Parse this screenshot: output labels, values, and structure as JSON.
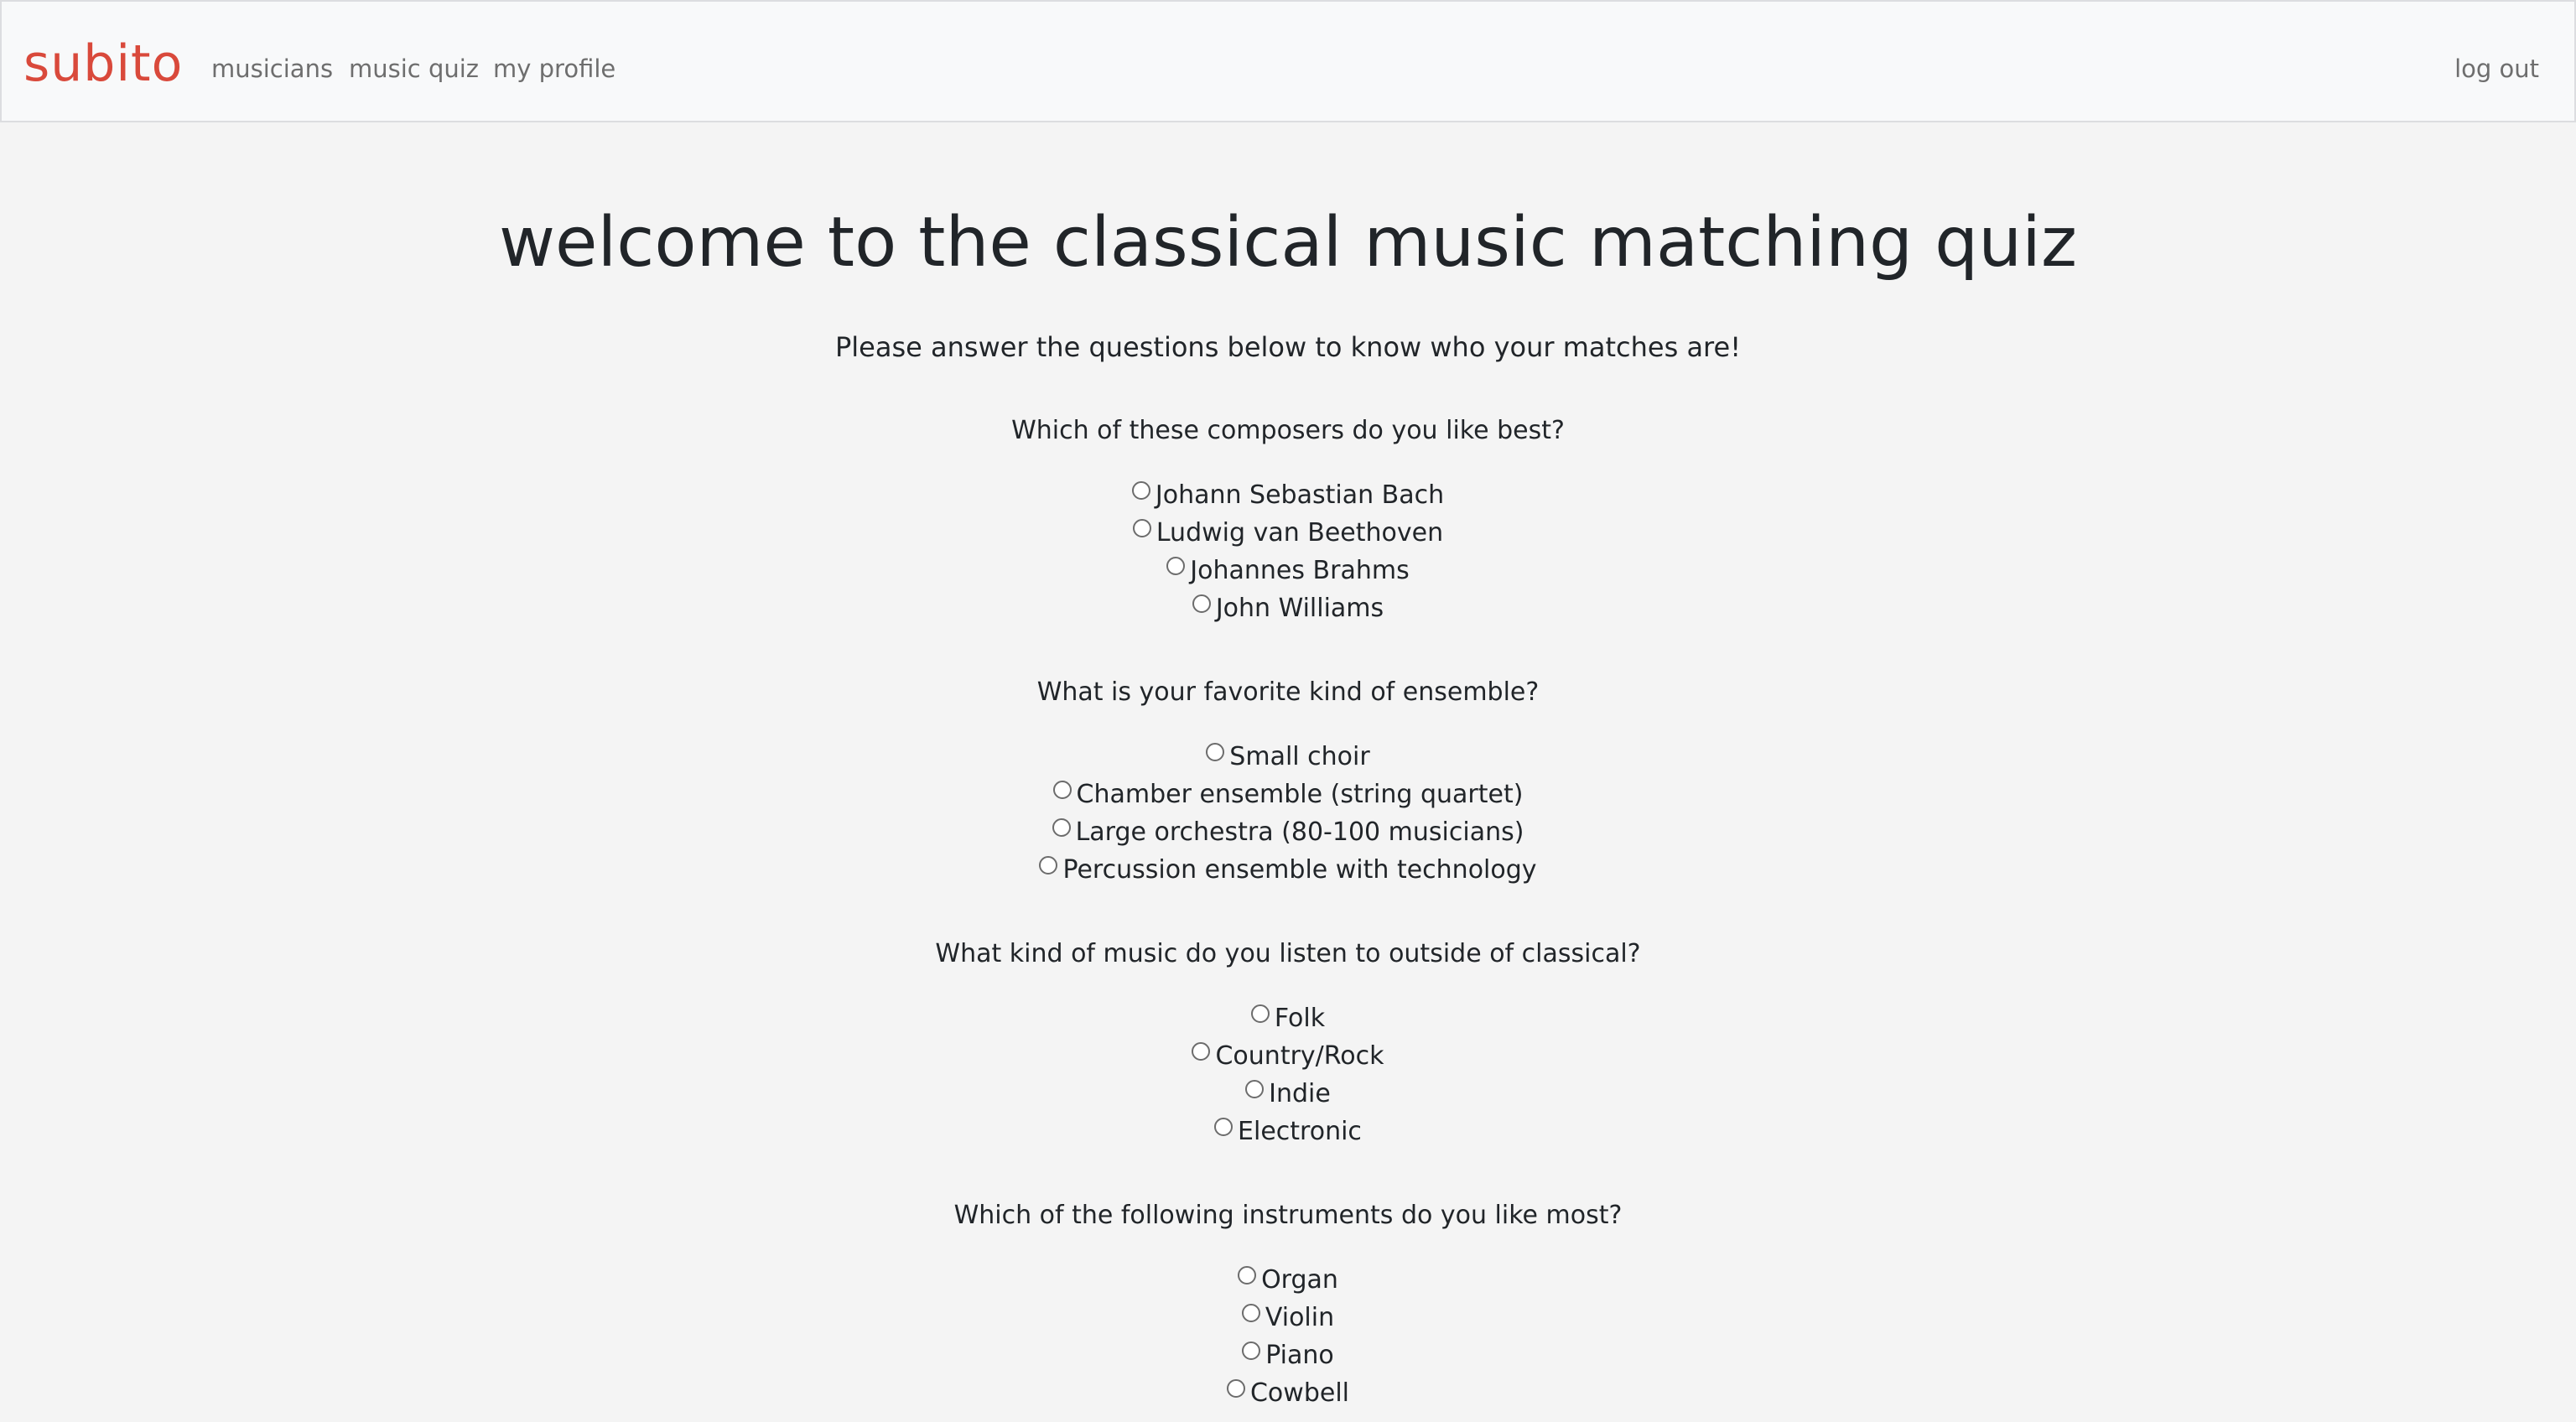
{
  "nav": {
    "brand": "subito",
    "links": [
      "musicians",
      "music quiz",
      "my profile"
    ],
    "logout": "log out"
  },
  "colors": {
    "brand": "#d9493b",
    "nav_background": "#f8f9fa",
    "page_background": "#f4f4f4"
  },
  "page": {
    "title": "welcome to the classical music matching quiz",
    "intro": "Please answer the questions below to know who your matches are!"
  },
  "questions": [
    {
      "text": "Which of these composers do you like best?",
      "options": [
        "Johann Sebastian Bach",
        "Ludwig van Beethoven",
        "Johannes Brahms",
        "John Williams"
      ]
    },
    {
      "text": "What is your favorite kind of ensemble?",
      "options": [
        "Small choir",
        "Chamber ensemble (string quartet)",
        "Large orchestra (80-100 musicians)",
        "Percussion ensemble with technology"
      ]
    },
    {
      "text": "What kind of music do you listen to outside of classical?",
      "options": [
        "Folk",
        "Country/Rock",
        "Indie",
        "Electronic"
      ]
    },
    {
      "text": "Which of the following instruments do you like most?",
      "options": [
        "Organ",
        "Violin",
        "Piano",
        "Cowbell"
      ]
    }
  ]
}
